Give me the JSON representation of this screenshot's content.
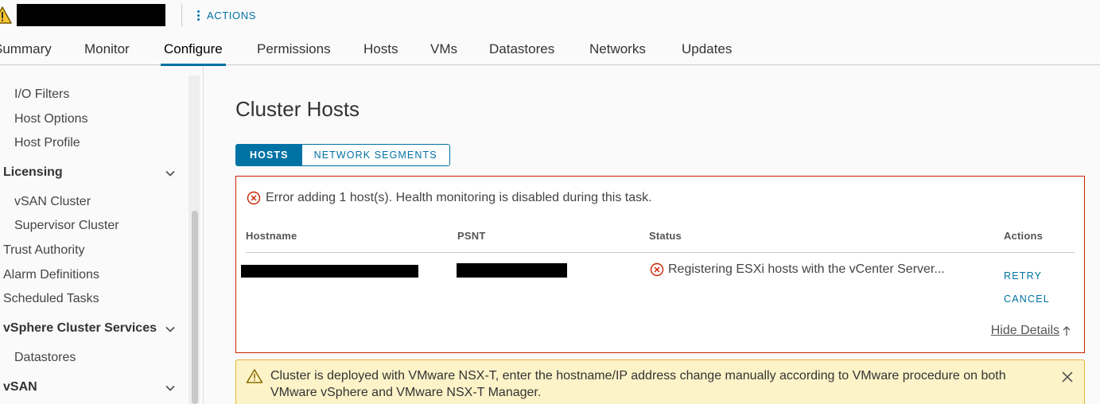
{
  "header": {
    "actions_label": "ACTIONS",
    "warning_icon": "warning-icon",
    "redacted_title": true
  },
  "tabs": [
    {
      "label": "Summary",
      "visible_text": "ummary"
    },
    {
      "label": "Monitor"
    },
    {
      "label": "Configure",
      "active": true
    },
    {
      "label": "Permissions"
    },
    {
      "label": "Hosts"
    },
    {
      "label": "VMs"
    },
    {
      "label": "Datastores"
    },
    {
      "label": "Networks"
    },
    {
      "label": "Updates"
    }
  ],
  "sidebar": {
    "items": [
      {
        "label": "I/O Filters",
        "level": "sub"
      },
      {
        "label": "Host Options",
        "level": "sub"
      },
      {
        "label": "Host Profile",
        "level": "sub"
      },
      {
        "label": "Licensing",
        "level": "group",
        "expanded": true
      },
      {
        "label": "vSAN Cluster",
        "level": "sub"
      },
      {
        "label": "Supervisor Cluster",
        "level": "sub"
      },
      {
        "label": "Trust Authority",
        "level": "top"
      },
      {
        "label": "Alarm Definitions",
        "level": "top"
      },
      {
        "label": "Scheduled Tasks",
        "level": "top"
      },
      {
        "label": "vSphere Cluster Services",
        "level": "group",
        "expanded": true
      },
      {
        "label": "Datastores",
        "level": "sub"
      },
      {
        "label": "vSAN",
        "level": "group",
        "expanded": true
      }
    ]
  },
  "main": {
    "title": "Cluster Hosts",
    "segments": [
      {
        "label": "HOSTS",
        "active": true
      },
      {
        "label": "NETWORK SEGMENTS",
        "active": false
      }
    ],
    "error": {
      "message": "Error adding 1 host(s). Health monitoring is disabled during this task.",
      "columns": [
        "Hostname",
        "PSNT",
        "Status",
        "Actions"
      ],
      "row": {
        "hostname": "[redacted]",
        "psnt": "[redacted]",
        "status": "Registering ESXi hosts with the vCenter Server...",
        "actions": [
          "RETRY",
          "CANCEL"
        ]
      },
      "hide_details": "Hide Details"
    },
    "warning": {
      "message": "Cluster is deployed with VMware NSX-T, enter the hostname/IP address change manually according to VMware procedure on both VMware vSphere and VMware NSX-T Manager."
    }
  },
  "colors": {
    "accent": "#0072a3",
    "error": "#c92100",
    "warning_bg": "#fdf3c8",
    "warning_border": "#e0b83a"
  }
}
